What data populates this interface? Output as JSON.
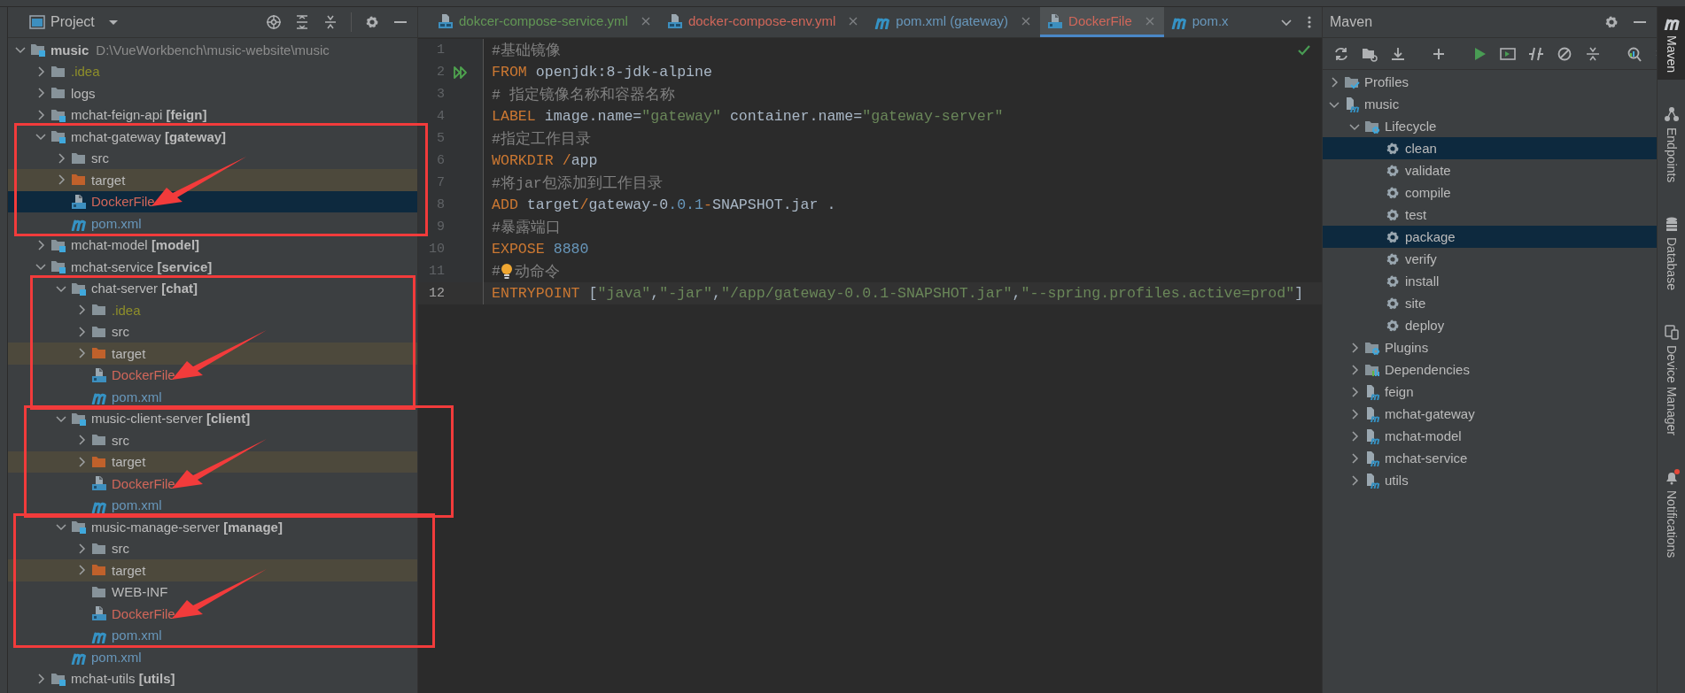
{
  "project_panel": {
    "title": "Project",
    "tree": [
      {
        "label": "music",
        "kind": "root",
        "path": "D:\\VueWorkbench\\music-website\\music",
        "expanded": true,
        "selected": false,
        "children": [
          {
            "label": ".idea",
            "kind": "folder",
            "expanded": false,
            "selected": false,
            "color": "#8e8e2a"
          },
          {
            "label": "logs",
            "kind": "folder",
            "expanded": false,
            "selected": false
          },
          {
            "label": "mchat-feign-api **[feign]**",
            "kind": "module",
            "expanded": false,
            "selected": false
          },
          {
            "label": "mchat-gateway **[gateway]**",
            "kind": "module",
            "expanded": true,
            "selected": false,
            "boxed": true,
            "children": [
              {
                "label": "src",
                "kind": "folder",
                "expanded": false,
                "selected": false
              },
              {
                "label": "target",
                "kind": "excluded",
                "expanded": false,
                "selected": false
              },
              {
                "label": "DockerFile",
                "kind": "docker",
                "selected": true,
                "color": "#d1675a",
                "arrow": true
              },
              {
                "label": "pom.xml",
                "kind": "maven",
                "selected": false,
                "color": "#6897bb"
              }
            ]
          },
          {
            "label": "mchat-model **[model]**",
            "kind": "module",
            "expanded": false,
            "selected": false
          },
          {
            "label": "mchat-service **[service]**",
            "kind": "module",
            "expanded": true,
            "selected": false,
            "children": [
              {
                "label": "chat-server **[chat]**",
                "kind": "module",
                "expanded": true,
                "selected": false,
                "boxed": true,
                "children": [
                  {
                    "label": ".idea",
                    "kind": "folder",
                    "expanded": false,
                    "selected": false,
                    "color": "#8e8e2a"
                  },
                  {
                    "label": "src",
                    "kind": "folder",
                    "expanded": false,
                    "selected": false
                  },
                  {
                    "label": "target",
                    "kind": "excluded",
                    "expanded": false,
                    "selected": false
                  },
                  {
                    "label": "DockerFile",
                    "kind": "docker",
                    "selected": false,
                    "color": "#d1675a",
                    "arrow": true
                  },
                  {
                    "label": "pom.xml",
                    "kind": "maven",
                    "selected": false,
                    "color": "#6897bb"
                  }
                ]
              },
              {
                "label": "music-client-server **[client]**",
                "kind": "module",
                "expanded": true,
                "selected": false,
                "boxed": true,
                "children": [
                  {
                    "label": "src",
                    "kind": "folder",
                    "expanded": false,
                    "selected": false
                  },
                  {
                    "label": "target",
                    "kind": "excluded",
                    "expanded": false,
                    "selected": false
                  },
                  {
                    "label": "DockerFile",
                    "kind": "docker",
                    "selected": false,
                    "color": "#d1675a",
                    "arrow": true
                  },
                  {
                    "label": "pom.xml",
                    "kind": "maven",
                    "selected": false,
                    "color": "#6897bb"
                  }
                ]
              },
              {
                "label": "music-manage-server **[manage]**",
                "kind": "module",
                "expanded": true,
                "selected": false,
                "boxed": true,
                "children": [
                  {
                    "label": "src",
                    "kind": "folder",
                    "expanded": false,
                    "selected": false
                  },
                  {
                    "label": "target",
                    "kind": "excluded",
                    "expanded": false,
                    "selected": false
                  },
                  {
                    "label": "WEB-INF",
                    "kind": "folder",
                    "selected": false
                  },
                  {
                    "label": "DockerFile",
                    "kind": "docker",
                    "selected": false,
                    "color": "#d1675a",
                    "arrow": true
                  },
                  {
                    "label": "pom.xml",
                    "kind": "maven",
                    "selected": false,
                    "color": "#6897bb"
                  }
                ]
              },
              {
                "label": "pom.xml",
                "kind": "maven",
                "selected": false,
                "color": "#6897bb"
              }
            ]
          },
          {
            "label": "mchat-utils **[utils]**",
            "kind": "module",
            "expanded": false,
            "selected": false
          }
        ]
      }
    ]
  },
  "editor": {
    "tabs": [
      {
        "label": "dokcer-compose-service.yml",
        "kind": "compose",
        "color": "#629755",
        "selected": false
      },
      {
        "label": "docker-compose-env.yml",
        "kind": "compose",
        "color": "#d1675a",
        "selected": false
      },
      {
        "label": "pom.xml (gateway)",
        "kind": "maven",
        "color": "#6897bb",
        "selected": false
      },
      {
        "label": "DockerFile",
        "kind": "docker",
        "color": "#d1675a",
        "selected": true
      },
      {
        "label": "pom.x",
        "kind": "maven",
        "color": "#6897bb",
        "selected": false
      }
    ],
    "lines": [
      {
        "number": "1",
        "current": false,
        "tokens": [
          {
            "kind": "comment",
            "text": "#基础镜像"
          }
        ]
      },
      {
        "number": "2",
        "current": false,
        "run": true,
        "tokens": [
          {
            "kind": "keyword",
            "text": "FROM"
          },
          {
            "kind": "plain",
            "text": " openjdk:8-jdk-alpine"
          }
        ]
      },
      {
        "number": "3",
        "current": false,
        "tokens": [
          {
            "kind": "comment",
            "text": "# 指定镜像名称和容器名称"
          }
        ]
      },
      {
        "number": "4",
        "current": false,
        "tokens": [
          {
            "kind": "keyword",
            "text": "LABEL"
          },
          {
            "kind": "plain",
            "text": " image.name="
          },
          {
            "kind": "string",
            "text": "\"gateway\""
          },
          {
            "kind": "plain",
            "text": " container.name="
          },
          {
            "kind": "string",
            "text": "\"gateway-server\""
          }
        ]
      },
      {
        "number": "5",
        "current": false,
        "tokens": [
          {
            "kind": "comment",
            "text": "#指定工作目录"
          }
        ]
      },
      {
        "number": "6",
        "current": false,
        "tokens": [
          {
            "kind": "keyword",
            "text": "WORKDIR"
          },
          {
            "kind": "keyword",
            "text": " /"
          },
          {
            "kind": "plain",
            "text": "app"
          }
        ]
      },
      {
        "number": "7",
        "current": false,
        "tokens": [
          {
            "kind": "comment",
            "text": "#将jar包添加到工作目录"
          }
        ]
      },
      {
        "number": "8",
        "current": false,
        "tokens": [
          {
            "kind": "keyword",
            "text": "ADD"
          },
          {
            "kind": "plain",
            "text": " target"
          },
          {
            "kind": "keyword",
            "text": "/"
          },
          {
            "kind": "plain",
            "text": "gateway-0"
          },
          {
            "kind": "number",
            "text": ".0.1"
          },
          {
            "kind": "keyword",
            "text": "-"
          },
          {
            "kind": "plain",
            "text": "SNAPSHOT.jar ."
          }
        ]
      },
      {
        "number": "9",
        "current": false,
        "tokens": [
          {
            "kind": "comment",
            "text": "#暴露端口"
          }
        ]
      },
      {
        "number": "10",
        "current": false,
        "tokens": [
          {
            "kind": "keyword",
            "text": "EXPOSE"
          },
          {
            "kind": "number",
            "text": " 8880"
          }
        ]
      },
      {
        "number": "11",
        "current": false,
        "tokens": [
          {
            "kind": "comment",
            "text": "#"
          },
          {
            "kind": "bulb"
          },
          {
            "kind": "comment",
            "text": "动命令"
          }
        ]
      },
      {
        "number": "12",
        "current": true,
        "tokens": [
          {
            "kind": "keyword",
            "text": "ENTRYPOINT"
          },
          {
            "kind": "plain",
            "text": " ["
          },
          {
            "kind": "string",
            "text": "\"java\""
          },
          {
            "kind": "plain",
            "text": ","
          },
          {
            "kind": "string",
            "text": "\"-jar\""
          },
          {
            "kind": "plain",
            "text": ","
          },
          {
            "kind": "string",
            "text": "\"/app/gateway-0.0.1-SNAPSHOT.jar\""
          },
          {
            "kind": "plain",
            "text": ","
          },
          {
            "kind": "string",
            "text": "\"--spring.profiles.active=prod\""
          },
          {
            "kind": "plain",
            "text": "]"
          }
        ]
      }
    ]
  },
  "maven_panel": {
    "title": "Maven",
    "tree": [
      {
        "label": "Profiles",
        "kind": "profiles",
        "expanded": false,
        "selected": false
      },
      {
        "label": "music",
        "kind": "project",
        "expanded": true,
        "selected": false,
        "children": [
          {
            "label": "Lifecycle",
            "kind": "lifecycle",
            "expanded": true,
            "selected": false,
            "children": [
              {
                "label": "clean",
                "kind": "goal",
                "selected": true
              },
              {
                "label": "validate",
                "kind": "goal",
                "selected": false
              },
              {
                "label": "compile",
                "kind": "goal",
                "selected": false
              },
              {
                "label": "test",
                "kind": "goal",
                "selected": false
              },
              {
                "label": "package",
                "kind": "goal",
                "selected": true
              },
              {
                "label": "verify",
                "kind": "goal",
                "selected": false
              },
              {
                "label": "install",
                "kind": "goal",
                "selected": false
              },
              {
                "label": "site",
                "kind": "goal",
                "selected": false
              },
              {
                "label": "deploy",
                "kind": "goal",
                "selected": false
              }
            ]
          },
          {
            "label": "Plugins",
            "kind": "plugins",
            "expanded": false,
            "selected": false
          },
          {
            "label": "Dependencies",
            "kind": "dependencies",
            "expanded": false,
            "selected": false
          },
          {
            "label": "feign",
            "kind": "project",
            "expanded": false,
            "selected": false
          },
          {
            "label": "mchat-gateway",
            "kind": "project",
            "expanded": false,
            "selected": false
          },
          {
            "label": "mchat-model",
            "kind": "project",
            "expanded": false,
            "selected": false
          },
          {
            "label": "mchat-service",
            "kind": "project",
            "expanded": false,
            "selected": false
          },
          {
            "label": "utils",
            "kind": "project",
            "expanded": false,
            "selected": false
          }
        ]
      }
    ]
  },
  "right_toolbar": [
    {
      "label": "Maven",
      "kind": "maven",
      "selected": true
    },
    {
      "label": "Endpoints",
      "kind": "endpoints",
      "selected": false
    },
    {
      "label": "Database",
      "kind": "database",
      "selected": false
    },
    {
      "label": "Device Manager",
      "kind": "device",
      "selected": false
    },
    {
      "label": "Notifications",
      "kind": "notifications",
      "selected": false,
      "unread": true
    }
  ]
}
